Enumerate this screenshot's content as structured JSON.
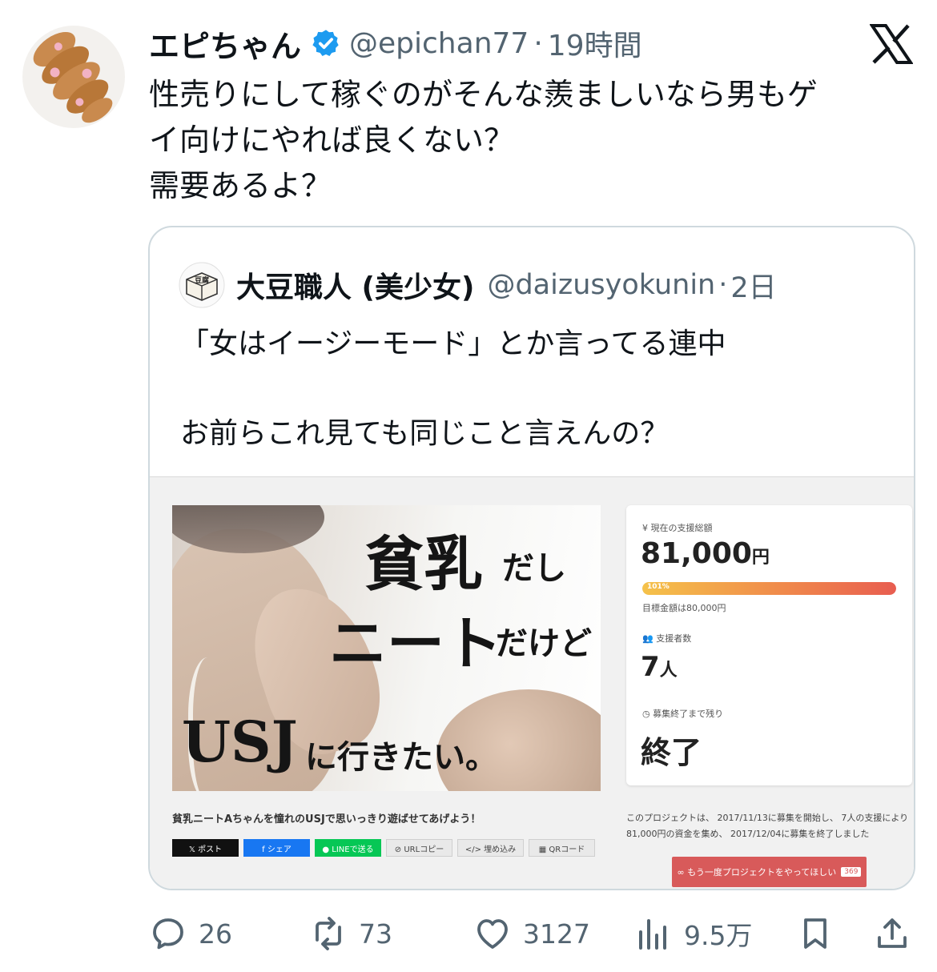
{
  "tweet": {
    "author_name": "エピちゃん",
    "handle": "@epichan77",
    "separator": "·",
    "time": "19時間",
    "text_lines": [
      "性売りにして稼ぐのがそんな羨ましいなら男もゲ",
      "イ向けにやれば良くない？",
      "需要あるよ？"
    ]
  },
  "quote": {
    "author_name": "大豆職人 (美少女)",
    "handle": "@daizusyokunin",
    "separator": "·",
    "time": "2日",
    "avatar_label": "豆腐",
    "text_lines": [
      "「女はイージーモード」とか言ってる連中",
      "お前らこれ見ても同じこと言えんの？"
    ]
  },
  "project": {
    "hero": {
      "line1_big": "貧乳",
      "line1_small": "だし",
      "line2_big": "ニート",
      "line2_small": "だけど",
      "line3_big": "USJ",
      "line3_small": "に行きたい。"
    },
    "caption": "貧乳ニートAちゃんを憧れのUSJで思いっきり遊ばせてあげよう！",
    "share_buttons": [
      "𝕏 ポスト",
      "f シェア",
      "● LINEで送る",
      "⊘ URLコピー",
      "</> 埋め込み",
      "▦ QRコード"
    ],
    "stats": {
      "total_label": "¥ 現在の支援総額",
      "total_amount": "81,000",
      "total_unit": "円",
      "progress_label": "101%",
      "progress": 1.01,
      "goal": "目標金額は80,000円",
      "backers_label": "支援者数",
      "backers_count": "7",
      "backers_unit": "人",
      "remaining_label": "募集終了まで残り",
      "remaining_value": "終了"
    },
    "summary_lines": [
      "このプロジェクトは、 2017/11/13に募集を開始し、 7人の支援により",
      "81,000円の資金を集め、 2017/12/04に募集を終了しました"
    ],
    "again_button": "∞ もう一度プロジェクトをやってほしい",
    "again_count": "369"
  },
  "actions": {
    "replies": "26",
    "reposts": "73",
    "likes": "3127",
    "views": "9.5万"
  },
  "colors": {
    "text": "#0f1419",
    "muted": "#536471",
    "verified": "#1d9bf0",
    "border": "#cfd9de",
    "again_button": "#d85a5a"
  }
}
